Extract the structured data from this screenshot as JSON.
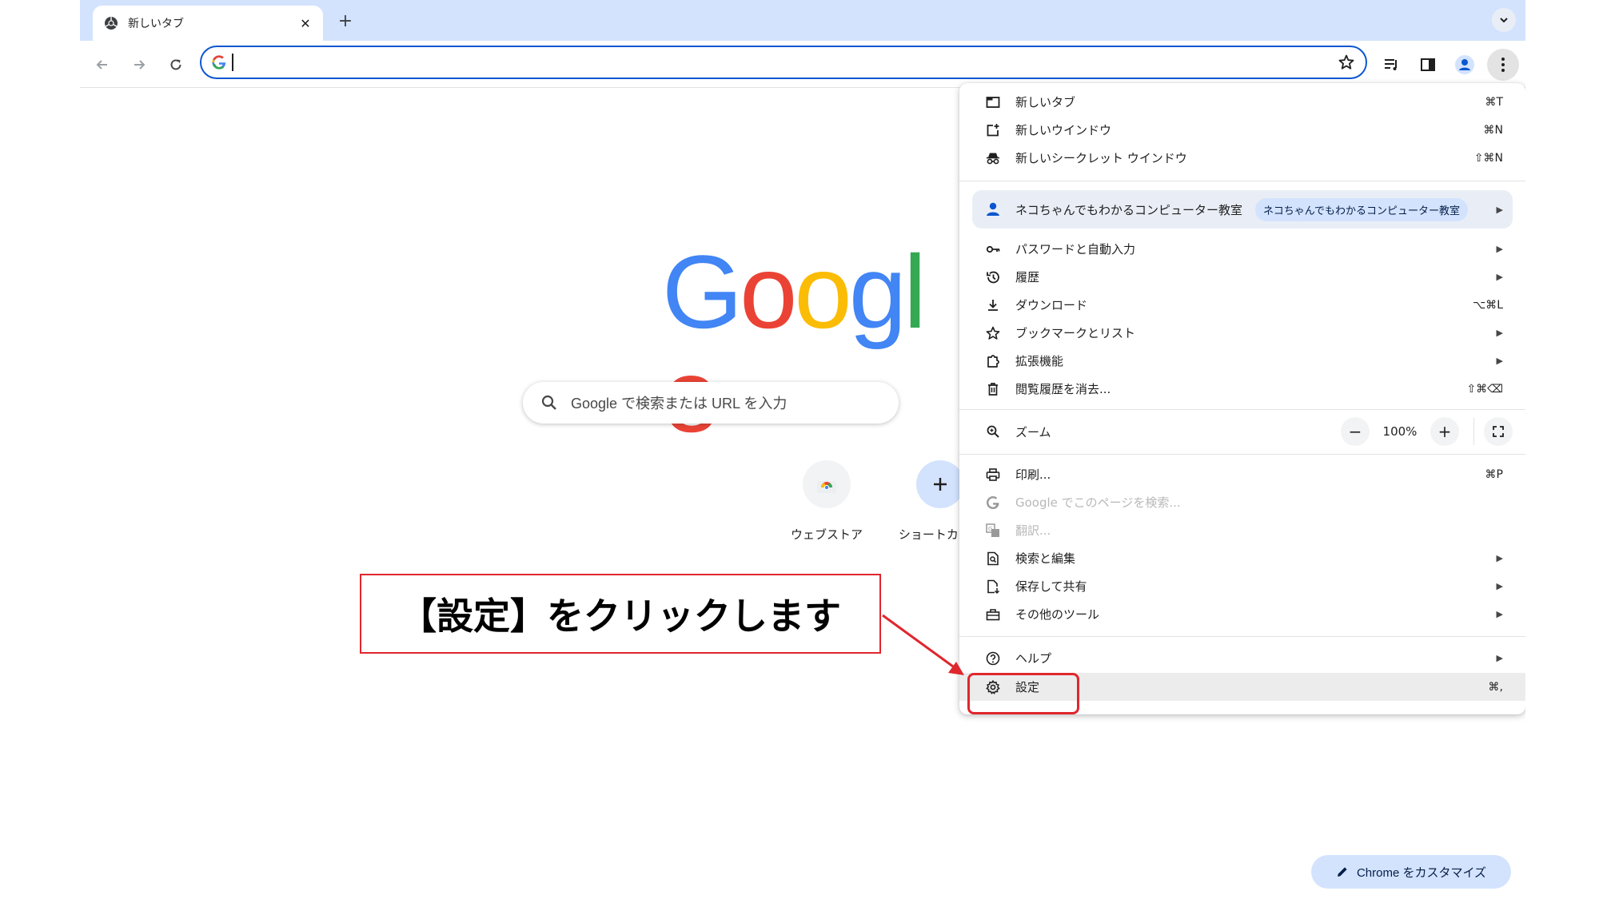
{
  "tab": {
    "title": "新しいタブ"
  },
  "omnibox": {
    "value": ""
  },
  "page": {
    "logo": [
      "G",
      "o",
      "o",
      "g",
      "l",
      "e"
    ],
    "search_placeholder": "Google で検索または URL を入力",
    "shortcuts": [
      {
        "label": "ウェブストア"
      },
      {
        "label": "ショートカッ..."
      }
    ],
    "customize_label": "Chrome をカスタマイズ"
  },
  "menu": {
    "new_tab": {
      "label": "新しいタブ",
      "shortcut": "⌘T"
    },
    "new_window": {
      "label": "新しいウインドウ",
      "shortcut": "⌘N"
    },
    "new_incognito": {
      "label": "新しいシークレット ウインドウ",
      "shortcut": "⇧⌘N"
    },
    "profile": {
      "name": "ネコちゃんでもわかるコンピューター教室",
      "chip": "ネコちゃんでもわかるコンピューター教室"
    },
    "passwords": {
      "label": "パスワードと自動入力"
    },
    "history": {
      "label": "履歴"
    },
    "downloads": {
      "label": "ダウンロード",
      "shortcut": "⌥⌘L"
    },
    "bookmarks": {
      "label": "ブックマークとリスト"
    },
    "extensions": {
      "label": "拡張機能"
    },
    "clear_data": {
      "label": "閲覧履歴を消去...",
      "shortcut": "⇧⌘⌫"
    },
    "zoom": {
      "label": "ズーム",
      "value": "100%",
      "minus": "−",
      "plus": "+"
    },
    "print": {
      "label": "印刷...",
      "shortcut": "⌘P"
    },
    "search_page": {
      "label": "Google でこのページを検索..."
    },
    "translate": {
      "label": "翻訳..."
    },
    "find_edit": {
      "label": "検索と編集"
    },
    "save_share": {
      "label": "保存して共有"
    },
    "more_tools": {
      "label": "その他のツール"
    },
    "help": {
      "label": "ヘルプ"
    },
    "settings": {
      "label": "設定",
      "shortcut": "⌘,"
    }
  },
  "annotation": {
    "text": "【設定】をクリックします"
  },
  "colors": {
    "google_blue": "#4285f4",
    "google_red": "#ea4335",
    "google_yellow": "#fbbc05",
    "google_green": "#34a853",
    "accent": "#0b57d0",
    "annotation_red": "#e0262d"
  },
  "icons": {
    "tab_favicon": "chrome-icon",
    "back": "arrow-left-icon",
    "forward": "arrow-right-icon",
    "reload": "reload-icon",
    "bookmark": "star-icon",
    "reading_list": "reading-list-icon",
    "side_panel": "side-panel-icon",
    "profile": "person-icon",
    "menu": "more-vert-icon",
    "search": "magnifier-icon"
  }
}
